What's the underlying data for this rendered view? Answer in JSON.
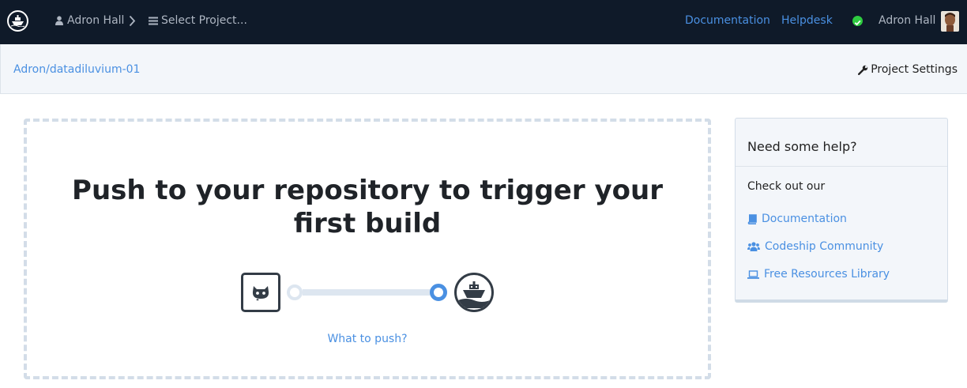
{
  "topbar": {
    "logo_icon": "codeship-ship-icon",
    "user_crumb": "Adron Hall",
    "project_select": "Select Project...",
    "nav_docs": "Documentation",
    "nav_helpdesk": "Helpdesk",
    "status_color": "#2ecc40",
    "account_name": "Adron Hall"
  },
  "subbar": {
    "repo_path": "Adron/datadiluvium-01",
    "settings_label": "Project Settings"
  },
  "main": {
    "headline": "Push to your repository to trigger your first build",
    "what_to_push": "What to push?",
    "accent_color": "#4a90e2"
  },
  "help": {
    "title": "Need some help?",
    "intro": "Check out our",
    "links": [
      {
        "label": "Documentation",
        "icon": "book-icon"
      },
      {
        "label": "Codeship Community",
        "icon": "users-icon"
      },
      {
        "label": "Free Resources Library",
        "icon": "laptop-icon"
      }
    ]
  }
}
